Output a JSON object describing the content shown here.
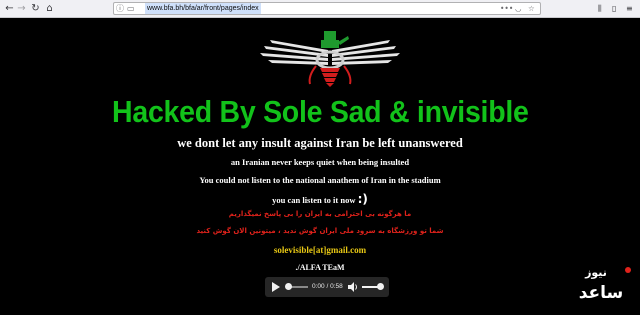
{
  "browser": {
    "url": "www.bfa.bh/bfa/ar/front/pages/index",
    "icons": {
      "back": "back-arrow-icon",
      "forward": "forward-arrow-icon",
      "reload": "reload-icon",
      "home": "home-icon",
      "site_info": "info-icon",
      "permissions": "permissions-icon",
      "page_actions": "more-icon",
      "pocket": "pocket-icon",
      "bookmark": "star-icon",
      "library": "library-icon",
      "sidebar": "sidebar-icon",
      "menu": "hamburger-menu-icon"
    }
  },
  "page": {
    "headline": "Hacked By Sole Sad & invisible",
    "line1": "we dont let any insult against Iran be left unanswered",
    "line2": "an Iranian never keeps quiet when being insulted",
    "line3": "You could not listen to the national anathem of Iran in the stadium",
    "line4": "you can listen to it now",
    "line4_smiley": ":)",
    "persian1": "ما هرگونه بی احترامی به ایران را بی پاسخ نمیگذاریم",
    "persian2": "شما تو ورزشگاه به سرود ملی ایران گوش ندید ، میتونین الان گوش کنید",
    "email": "solevisible[at]gmail.com",
    "team": "./ALFA TEaM",
    "emblem": "faravahar-emblem",
    "colors": {
      "background": "#000000",
      "headline": "#12c21a",
      "persian": "#e0221b",
      "email": "#e8c814"
    }
  },
  "player": {
    "time": "0:00 / 0:58",
    "progress": 0.0,
    "volume": 0.8,
    "icons": {
      "play": "play-icon",
      "volume": "volume-icon"
    }
  },
  "watermark": {
    "text": "نیوز ساعد",
    "logo": "news-logo"
  }
}
